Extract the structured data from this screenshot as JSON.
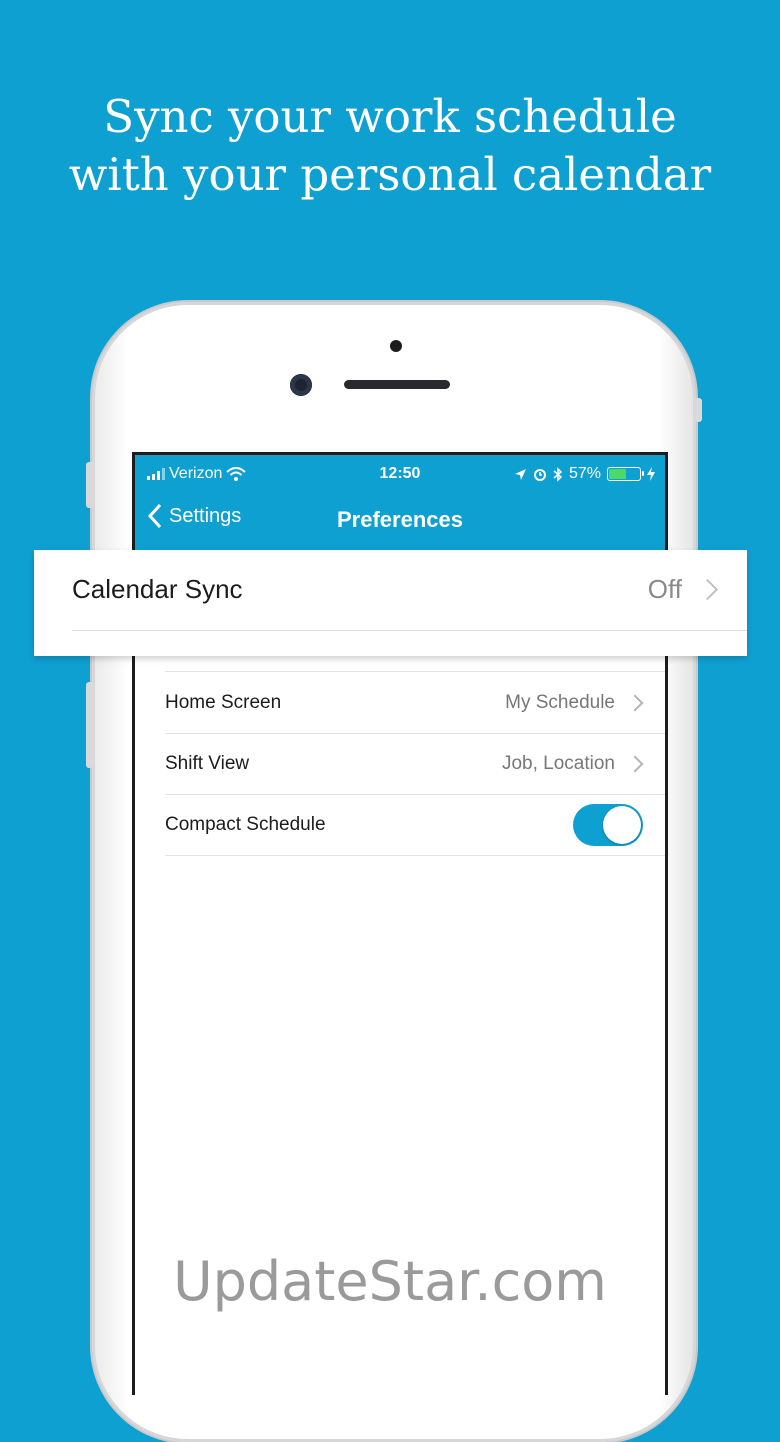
{
  "headline": {
    "line1": "Sync your work schedule",
    "line2": "with your personal calendar"
  },
  "status_bar": {
    "carrier": "Verizon",
    "time": "12:50",
    "battery": "57%",
    "battery_level": 0.57
  },
  "nav": {
    "back_label": "Settings",
    "title": "Preferences"
  },
  "callout": {
    "label": "Calendar Sync",
    "value": "Off"
  },
  "rows": [
    {
      "label": "Home Screen",
      "value": "My Schedule"
    },
    {
      "label": "Shift View",
      "value": "Job, Location"
    },
    {
      "label": "Compact Schedule",
      "toggle_on": true
    }
  ],
  "watermark": "UpdateStar.com",
  "colors": {
    "background": "#0fa0d2",
    "toggle_on": "#0fa0d2",
    "battery_fill": "#4cd964"
  }
}
